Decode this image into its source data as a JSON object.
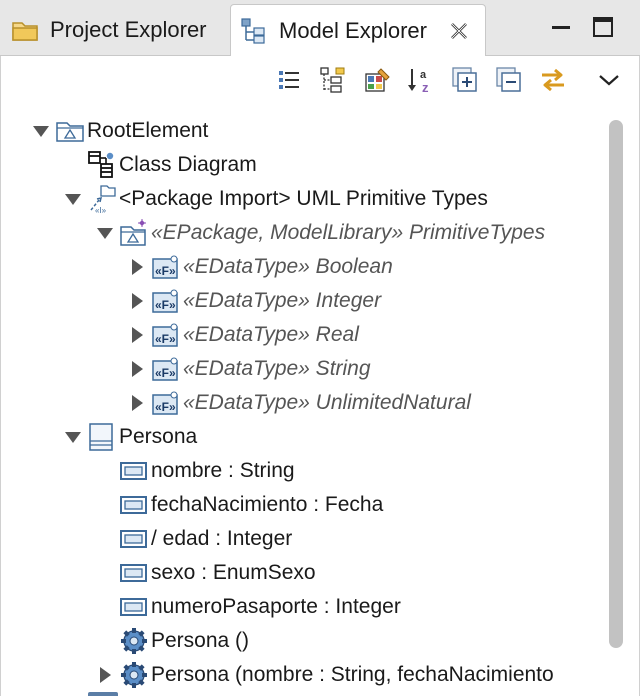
{
  "tabs": [
    {
      "label": "Project Explorer",
      "icon": "folder-icon",
      "active": false
    },
    {
      "label": "Model Explorer",
      "icon": "model-explorer-icon",
      "active": true
    }
  ],
  "window_buttons": [
    "minimize-icon",
    "maximize-icon"
  ],
  "toolbar": [
    "list-icon",
    "tree-view-icon",
    "palette-icon",
    "sort-az-icon",
    "expand-all-icon",
    "collapse-all-icon",
    "link-with-editor-icon",
    "view-menu-icon"
  ],
  "tree": [
    {
      "label": "RootElement",
      "icon": "model-icon",
      "twisty": "expanded",
      "italic": false
    },
    {
      "label": "Class Diagram",
      "icon": "class-diagram-icon",
      "twisty": "none",
      "italic": false
    },
    {
      "label": "<Package Import> UML Primitive Types",
      "icon": "package-import-icon",
      "twisty": "expanded",
      "italic": false
    },
    {
      "label": "«EPackage, ModelLibrary» PrimitiveTypes",
      "icon": "package-icon",
      "twisty": "expanded",
      "italic": true
    },
    {
      "label": "«EDataType» Boolean",
      "icon": "datatype-icon",
      "twisty": "collapsed",
      "italic": true
    },
    {
      "label": "«EDataType» Integer",
      "icon": "datatype-icon",
      "twisty": "collapsed",
      "italic": true
    },
    {
      "label": "«EDataType» Real",
      "icon": "datatype-icon",
      "twisty": "collapsed",
      "italic": true
    },
    {
      "label": "«EDataType» String",
      "icon": "datatype-icon",
      "twisty": "collapsed",
      "italic": true
    },
    {
      "label": "«EDataType» UnlimitedNatural",
      "icon": "datatype-icon",
      "twisty": "collapsed",
      "italic": true
    },
    {
      "label": "Persona",
      "icon": "class-icon",
      "twisty": "expanded",
      "italic": false
    },
    {
      "label": "nombre : String",
      "icon": "property-icon",
      "twisty": "none",
      "italic": false
    },
    {
      "label": "fechaNacimiento : Fecha",
      "icon": "property-icon",
      "twisty": "none",
      "italic": false
    },
    {
      "label": "/ edad : Integer",
      "icon": "property-icon",
      "twisty": "none",
      "italic": false
    },
    {
      "label": "sexo : EnumSexo",
      "icon": "property-icon",
      "twisty": "none",
      "italic": false
    },
    {
      "label": "numeroPasaporte : Integer",
      "icon": "property-icon",
      "twisty": "none",
      "italic": false
    },
    {
      "label": "Persona ()",
      "icon": "operation-icon",
      "twisty": "none",
      "italic": false
    },
    {
      "label": "Persona (nombre : String, fechaNacimiento",
      "icon": "operation-icon",
      "twisty": "collapsed",
      "italic": false
    }
  ]
}
